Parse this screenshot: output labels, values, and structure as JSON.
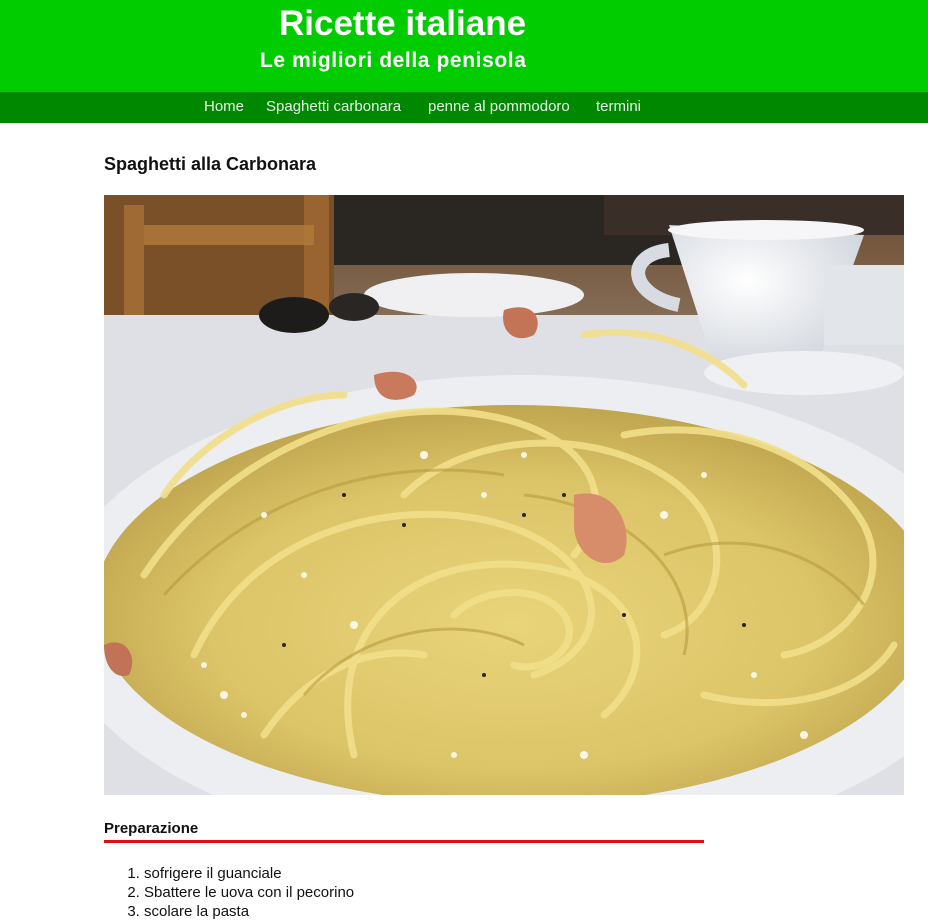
{
  "header": {
    "title": "Ricette italiane",
    "subtitle": "Le migliori della penisola",
    "background_color": "#00cc00"
  },
  "nav": {
    "background_color": "#008800",
    "items": [
      {
        "label": "Home"
      },
      {
        "label": "Spaghetti carbonara"
      },
      {
        "label": "penne al pommodoro"
      },
      {
        "label": "termini"
      }
    ]
  },
  "main": {
    "title": "Spaghetti alla Carbonara",
    "image": {
      "description_icon": "spaghetti-carbonara-photo"
    },
    "preparation": {
      "heading": "Preparazione",
      "rule_color": "#dd1111",
      "steps": [
        "sofrigere il guanciale",
        "Sbattere le uova con il pecorino",
        "scolare la pasta"
      ]
    }
  }
}
